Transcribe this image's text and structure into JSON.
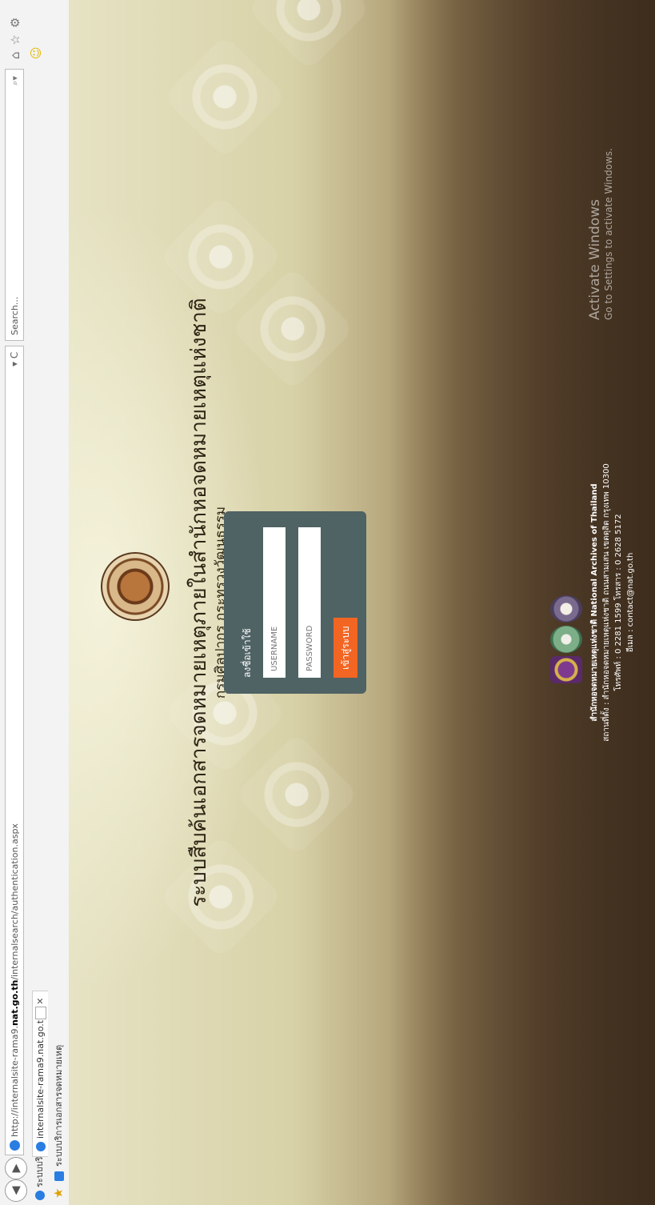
{
  "browser": {
    "address_prefix": "http://internalsite-rama9.",
    "address_host": "nat.go.th",
    "address_path": "/internalsearch/authentication.aspx",
    "refresh_glyph": "▾ C",
    "search_placeholder": "Search...",
    "tabs": [
      {
        "label": "ระบบบริการเอกสารจดหมายเหตุ"
      },
      {
        "label": "internalsite-rama9.nat.go.th"
      }
    ],
    "favorites": [
      {
        "label": "ระบบบริการเอกสารจดหมายเหตุ"
      }
    ]
  },
  "header": {
    "title": "ระบบสืบค้นเอกสารจดหมายเหตุภายในสำนักหอจดหมายเหตุแห่งชาติ",
    "subtitle": "กรมศิลปากร กระทรวงวัฒนธรรม"
  },
  "login": {
    "caption": "ลงชื่อเข้าใช้",
    "username_placeholder": "USERNAME",
    "password_placeholder": "PASSWORD",
    "submit_label": "เข้าสู่ระบบ"
  },
  "footer": {
    "line1": "สำนักหอจดหมายเหตุแห่งชาติ National Archives of Thailand",
    "line2": "สถานที่ตั้ง : สำนักหอจดหมายเหตุแห่งชาติ ถนนสามเสน เขตดุสิต กรุงเทพ 10300",
    "line3": "โทรศัพท์ : 0 2281 1599 โทรสาร : 0 2628 5172",
    "line4": "อีเมล : contact@nat.go.th"
  },
  "watermark": {
    "line1": "Activate Windows",
    "line2": "Go to Settings to activate Windows."
  },
  "colors": {
    "card": "#4f6264",
    "button": "#f26522"
  }
}
